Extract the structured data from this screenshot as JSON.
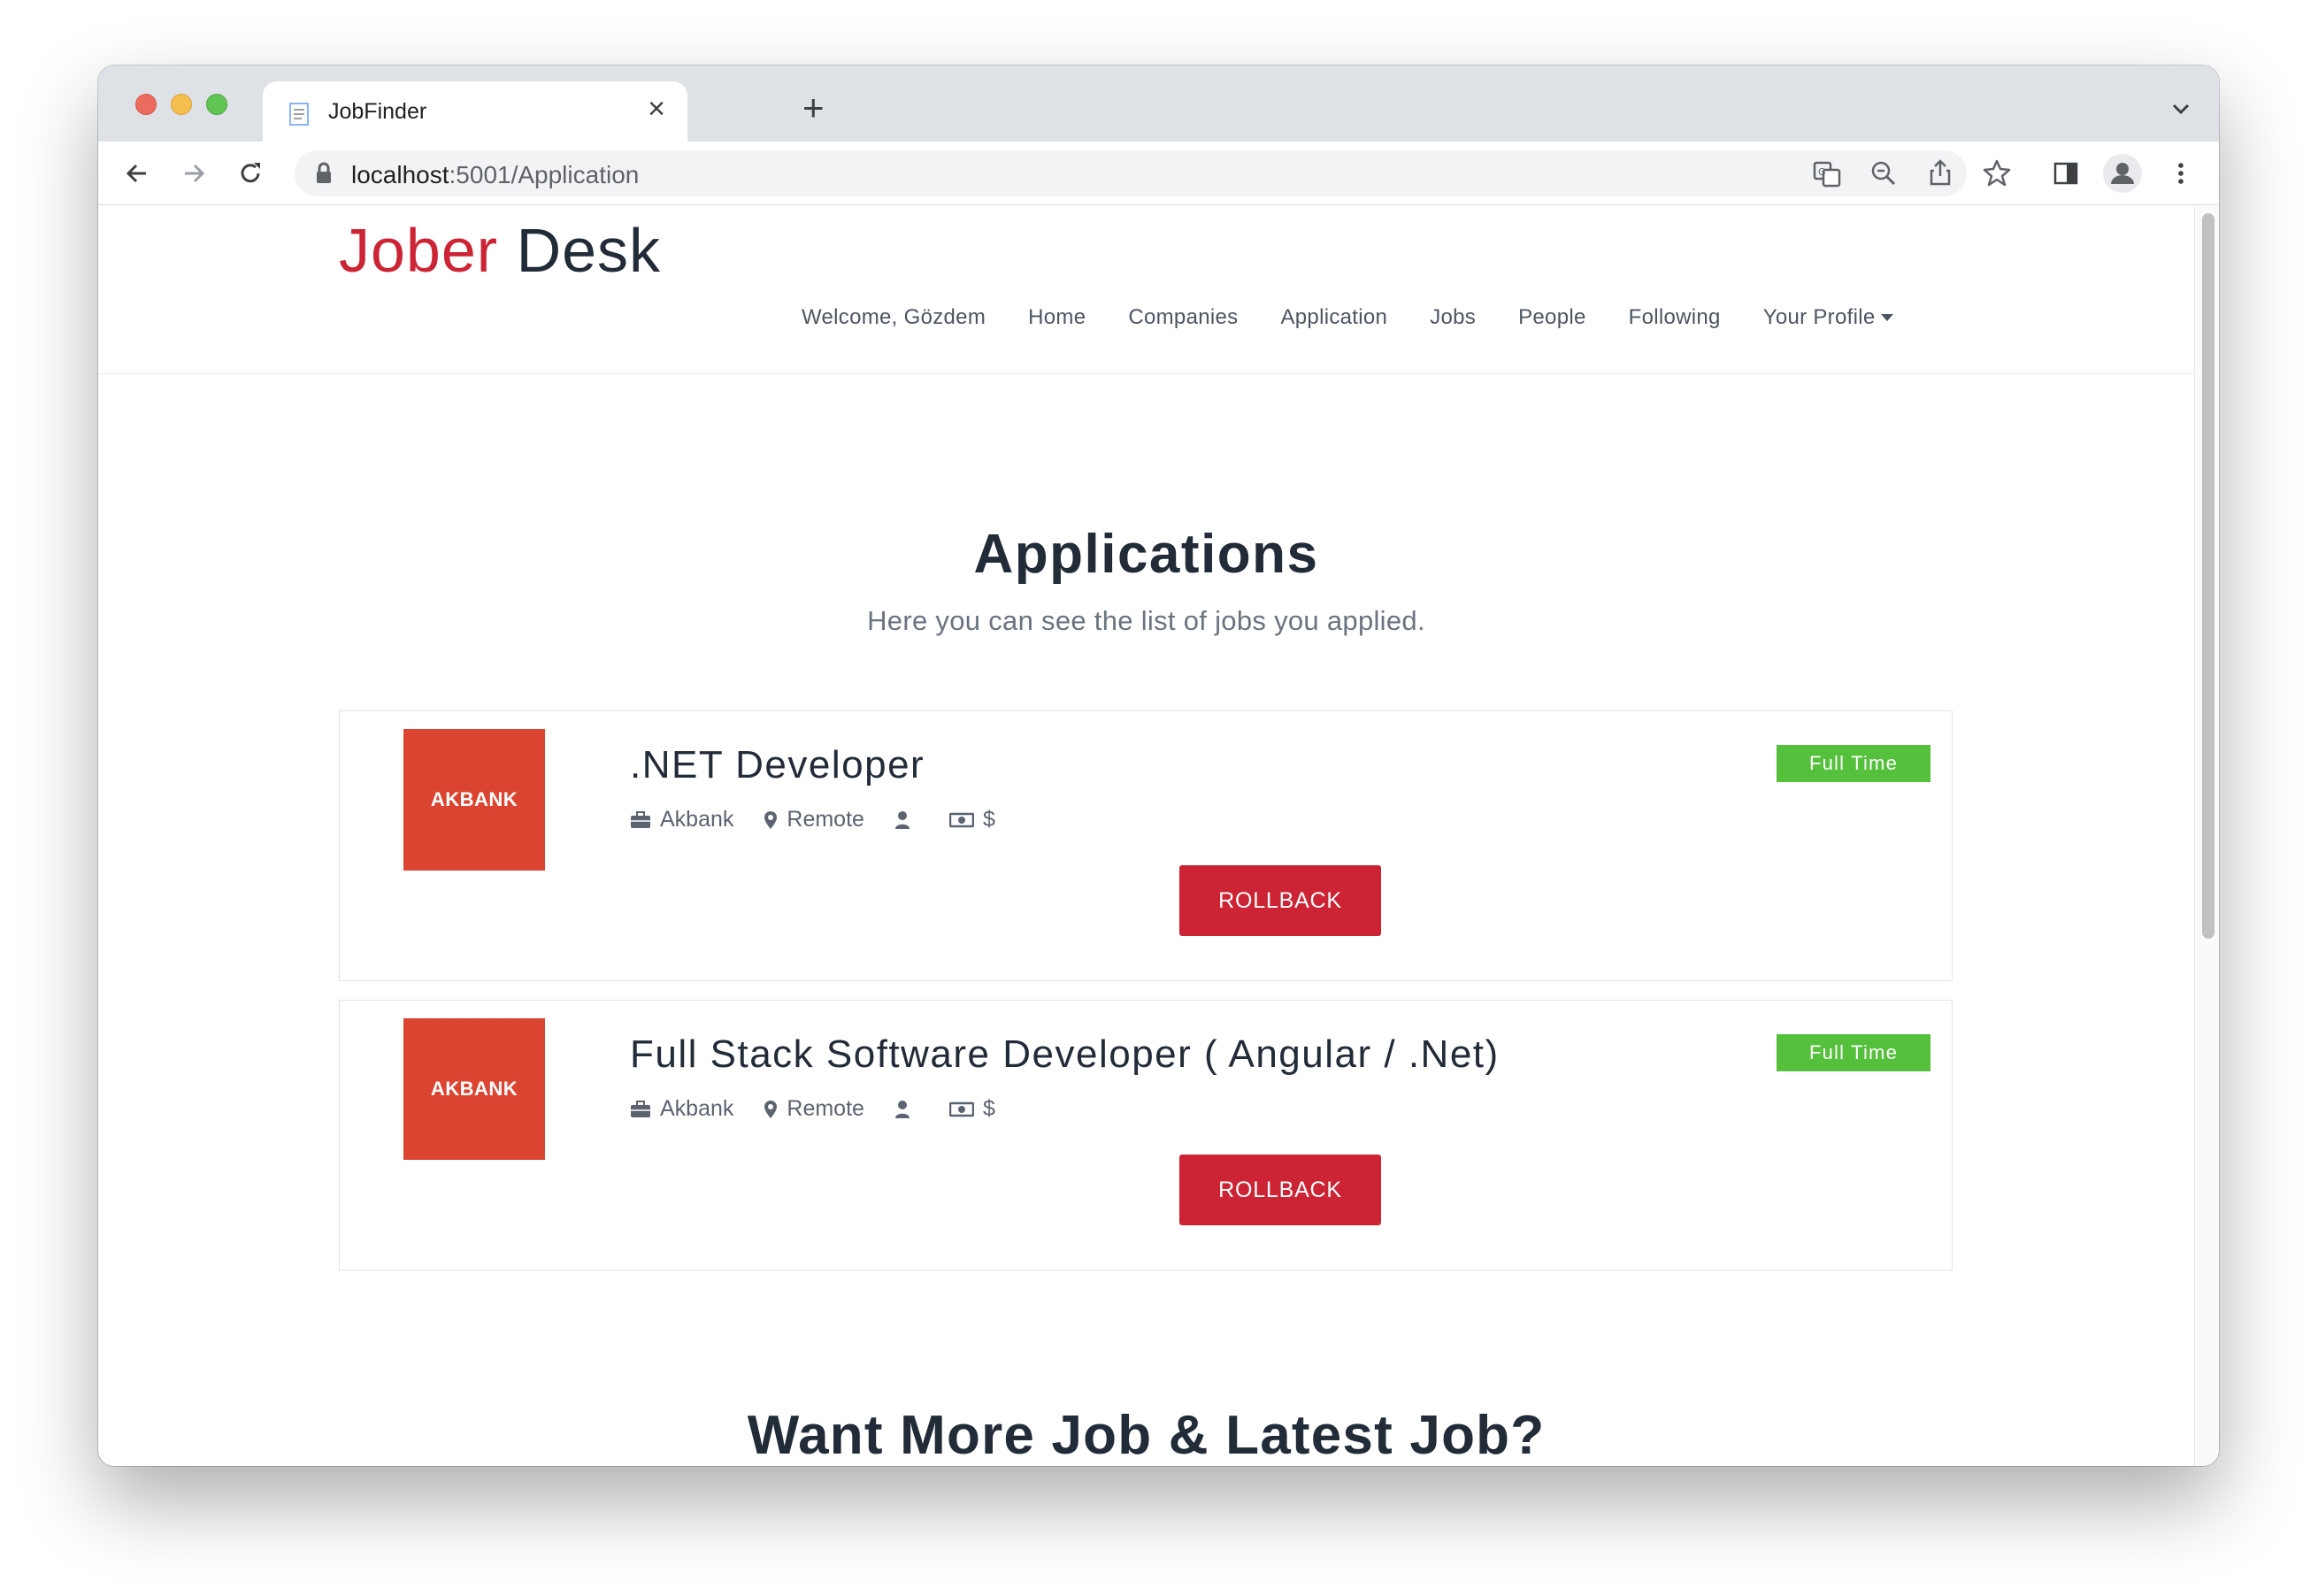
{
  "browser": {
    "tab_title": "JobFinder",
    "url_host": "localhost",
    "url_path": ":5001/Application"
  },
  "site": {
    "brand_first": "Jober",
    "brand_second": "Desk",
    "colors": {
      "brand_red": "#cc2434",
      "brand_dark": "#222b38",
      "badge_green": "#55c03c",
      "logo_red": "#db4431"
    },
    "nav": {
      "welcome": "Welcome, Gözdem",
      "home": "Home",
      "companies": "Companies",
      "application": "Application",
      "jobs": "Jobs",
      "people": "People",
      "following": "Following",
      "profile": "Your Profile"
    }
  },
  "main": {
    "title": "Applications",
    "subtitle": "Here you can see the list of jobs you applied.",
    "jobs": [
      {
        "logo_text": "AKBANK",
        "title": ".NET Developer",
        "company": "Akbank",
        "location": "Remote",
        "salary": "$",
        "type": "Full Time",
        "action": "ROLLBACK"
      },
      {
        "logo_text": "AKBANK",
        "title": "Full Stack Software Developer ( Angular / .Net)",
        "company": "Akbank",
        "location": "Remote",
        "salary": "$",
        "type": "Full Time",
        "action": "ROLLBACK"
      }
    ],
    "more_title": "Want More Job & Latest Job?"
  }
}
